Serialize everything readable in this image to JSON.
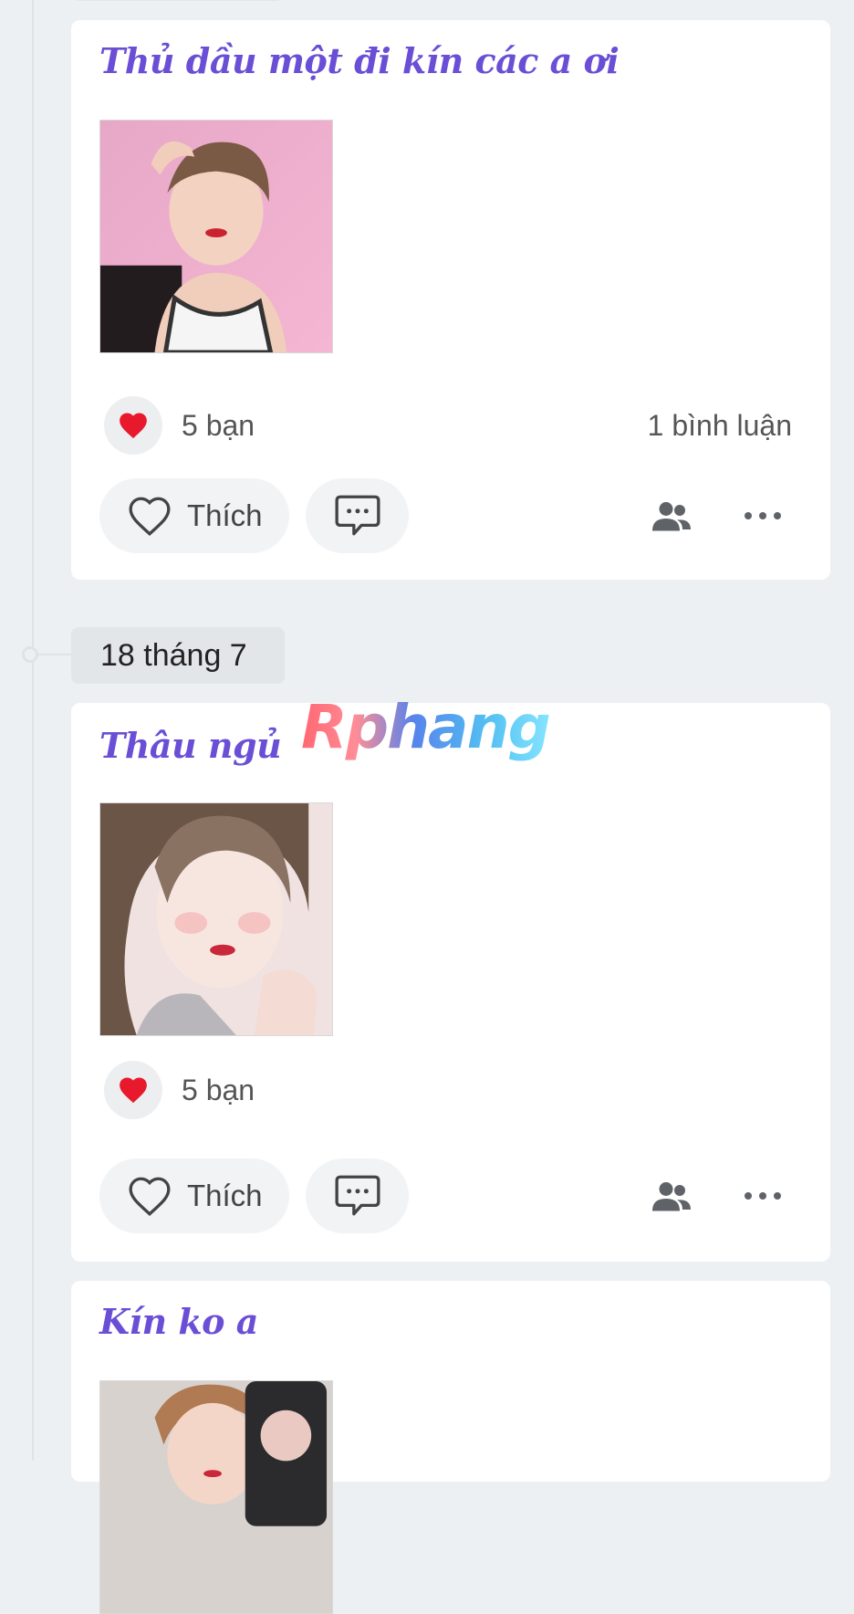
{
  "posts": [
    {
      "title": "Thủ dầu một đi kín các a ơi",
      "photo_alt": "selfie photo",
      "reaction_count": "5 bạn",
      "comment_count": "1 bình luận",
      "like_label": "Thích"
    },
    {
      "title": "Thâu ngủ",
      "photo_alt": "selfie photo",
      "reaction_count": "5 bạn",
      "comment_count": "",
      "like_label": "Thích"
    },
    {
      "title": "Kín ko a",
      "photo_alt": "selfie photo"
    }
  ],
  "timeline": {
    "date_label": "18 tháng 7"
  },
  "watermark": "Rphang",
  "colors": {
    "title": "#6a4fd6",
    "heart": "#e8192c",
    "background": "#edf0f2",
    "card": "#ffffff"
  },
  "icons": {
    "reaction": "heart-icon",
    "like": "heart-outline-icon",
    "comment": "chat-bubble-icon",
    "audience": "people-icon",
    "more": "more-dots-icon"
  }
}
